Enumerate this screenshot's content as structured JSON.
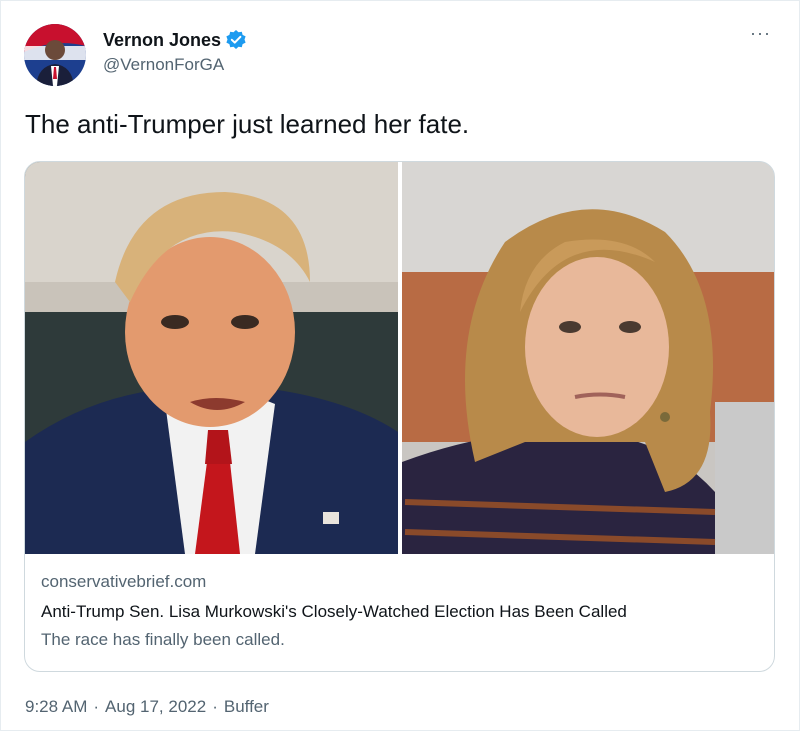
{
  "author": {
    "name": "Vernon Jones",
    "handle": "@VernonForGA",
    "verified": true,
    "icon": "verified-badge-icon"
  },
  "more_icon": "more-options-icon",
  "more_label": "···",
  "tweet": {
    "text": "The anti-Trumper just learned her fate."
  },
  "card": {
    "domain": "conservativebrief.com",
    "title": "Anti-Trump Sen. Lisa Murkowski's Closely-Watched Election Has Been Called",
    "description": "The race has finally been called."
  },
  "meta": {
    "time": "9:28 AM",
    "separator1": "·",
    "date": "Aug 17, 2022",
    "separator2": "·",
    "source": "Buffer"
  },
  "colors": {
    "verified": "#1d9bf0",
    "secondary_text": "#536471",
    "primary_text": "#0f1419",
    "border": "#cfd9de"
  }
}
